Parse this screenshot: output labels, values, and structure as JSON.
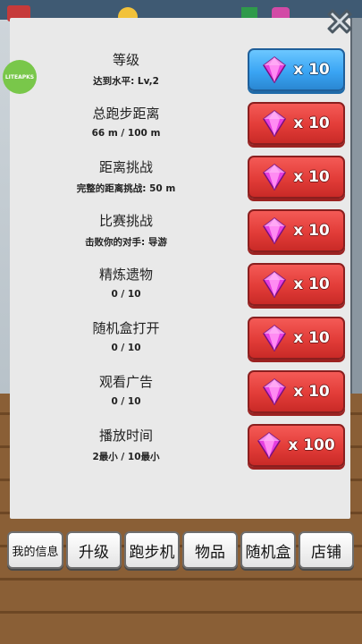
{
  "close_label": "close",
  "watermark": "LITEAPKS",
  "rows": [
    {
      "title": "等级",
      "subtitle": "达到水平: Lv,2",
      "reward": "x 10",
      "style": "blue"
    },
    {
      "title": "总跑步距离",
      "subtitle": "66 m / 100 m",
      "reward": "x 10",
      "style": "red"
    },
    {
      "title": "距离挑战",
      "subtitle": "完整的距离挑战: 50 m",
      "reward": "x 10",
      "style": "red"
    },
    {
      "title": "比赛挑战",
      "subtitle": "击败你的对手: 导游",
      "reward": "x 10",
      "style": "red"
    },
    {
      "title": "精炼遗物",
      "subtitle": "0 / 10",
      "reward": "x 10",
      "style": "red"
    },
    {
      "title": "随机盒打开",
      "subtitle": "0 / 10",
      "reward": "x 10",
      "style": "red"
    },
    {
      "title": "观看广告",
      "subtitle": "0 / 10",
      "reward": "x 10",
      "style": "red"
    },
    {
      "title": "播放时间",
      "subtitle": "2最小 / 10最小",
      "reward": "x 100",
      "style": "red"
    }
  ],
  "tabs": [
    {
      "label": "我的信息"
    },
    {
      "label": "升级"
    },
    {
      "label": "跑步机"
    },
    {
      "label": "物品"
    },
    {
      "label": "随机盒"
    },
    {
      "label": "店铺"
    }
  ],
  "colors": {
    "reward_red": "#e23c38",
    "reward_blue": "#3aa5f4",
    "gem": "#e040e0",
    "panel": "#e9e9e9"
  }
}
